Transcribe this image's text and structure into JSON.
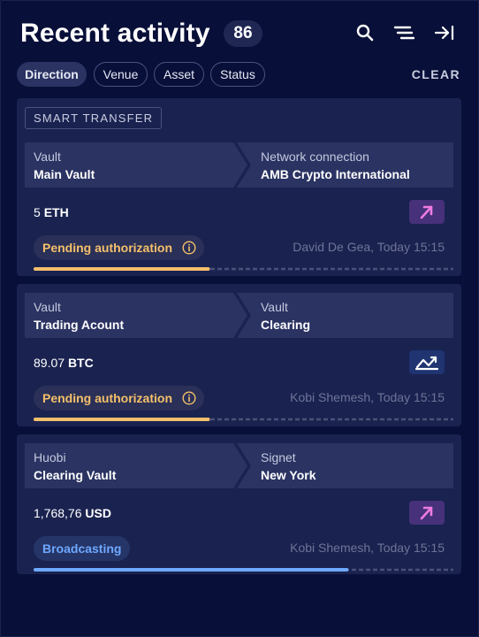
{
  "header": {
    "title": "Recent activity",
    "count": "86",
    "icons": [
      "search-icon",
      "filter-lines-icon",
      "collapse-right-icon"
    ]
  },
  "filters": {
    "chips": [
      {
        "label": "Direction",
        "active": true
      },
      {
        "label": "Venue",
        "active": false
      },
      {
        "label": "Asset",
        "active": false
      },
      {
        "label": "Status",
        "active": false
      }
    ],
    "clear_label": "CLEAR"
  },
  "colors": {
    "background": "#070d35",
    "card": "#1a2250",
    "pending": "#f5c06b",
    "broadcasting": "#6ea8ff",
    "type_button": "#46317a",
    "type_button_alt": "#1f3471"
  },
  "transactions": [
    {
      "tag": "SMART TRANSFER",
      "from_label": "Vault",
      "from_value": "Main Vault",
      "to_label": "Network connection",
      "to_value": "AMB Crypto International",
      "amount_number": "5",
      "amount_asset": "ETH",
      "type_icon": "arrow-up-right-icon",
      "status": "Pending authorization",
      "status_icon": "info-icon",
      "initiator": "David De Gea, Today 15:15",
      "progress": 0.42
    },
    {
      "tag": "",
      "from_label": "Vault",
      "from_value": "Trading Acount",
      "to_label": "Vault",
      "to_value": "Clearing",
      "amount_number": "89.07",
      "amount_asset": "BTC",
      "type_icon": "internal-transfer-icon",
      "status": "Pending authorization",
      "status_icon": "info-icon",
      "initiator": "Kobi Shemesh, Today 15:15",
      "progress": 0.42
    },
    {
      "tag": "",
      "from_label": "Huobi",
      "from_value": "Clearing Vault",
      "to_label": "Signet",
      "to_value": "New York",
      "amount_number": "1,768,76",
      "amount_asset": "USD",
      "type_icon": "arrow-up-right-icon",
      "status": "Broadcasting",
      "status_icon": "",
      "initiator": "Kobi Shemesh, Today 15:15",
      "progress": 0.75
    }
  ]
}
